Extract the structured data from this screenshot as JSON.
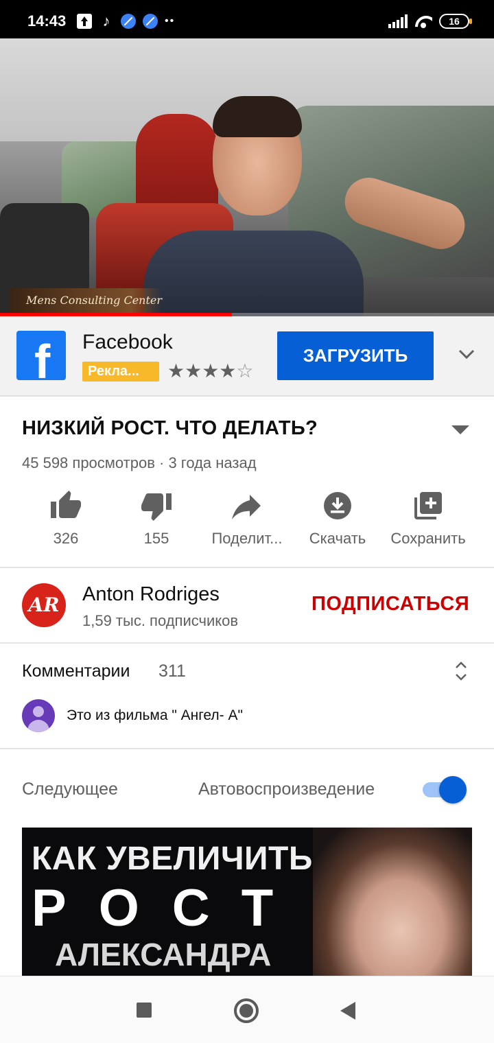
{
  "status_bar": {
    "time": "14:43",
    "battery": "16",
    "icons": [
      "upload-icon",
      "tiktok-icon",
      "app-blue-icon",
      "app-blue-icon",
      "more-dots-icon",
      "signal-icon",
      "wifi-icon",
      "battery-icon"
    ]
  },
  "video": {
    "watermark": "Mens Consulting Center",
    "progress_fraction": 0.47,
    "progress_color": "#ff0000"
  },
  "ad": {
    "advertiser": "Facebook",
    "badge": "Рекла...",
    "rating": 4,
    "stars": "★★★★",
    "empty_star": "☆",
    "cta": "ЗАГРУЗИТЬ",
    "cta_color": "#065fd4"
  },
  "video_info": {
    "title": "НИЗКИЙ РОСТ. ЧТО ДЕЛАТЬ?",
    "meta": "45 598 просмотров · 3 года назад"
  },
  "actions": [
    {
      "icon": "thumbs-up-icon",
      "label": "326"
    },
    {
      "icon": "thumbs-down-icon",
      "label": "155"
    },
    {
      "icon": "share-icon",
      "label": "Поделит..."
    },
    {
      "icon": "download-icon",
      "label": "Скачать"
    },
    {
      "icon": "save-to-playlist-icon",
      "label": "Сохранить"
    }
  ],
  "channel": {
    "avatar_text": "AR",
    "name": "Anton Rodriges",
    "subscribers": "1,59 тыс. подписчиков",
    "subscribe_label": "ПОДПИСАТЬСЯ",
    "subscribe_color": "#cc0000"
  },
  "comments": {
    "label": "Комментарии",
    "count": "311",
    "top_comment": "Это из фильма \" Ангел- А\""
  },
  "up_next": {
    "label": "Следующее",
    "autoplay_label": "Автовоспроизведение",
    "autoplay_on": true,
    "thumbnail": {
      "line1": "КАК УВЕЛИЧИТЬ",
      "line2": "РОСТ",
      "line3": "АЛЕКСАНДРА"
    }
  },
  "nav": {
    "icons": [
      "recents-square-icon",
      "home-circle-icon",
      "back-triangle-icon"
    ]
  }
}
